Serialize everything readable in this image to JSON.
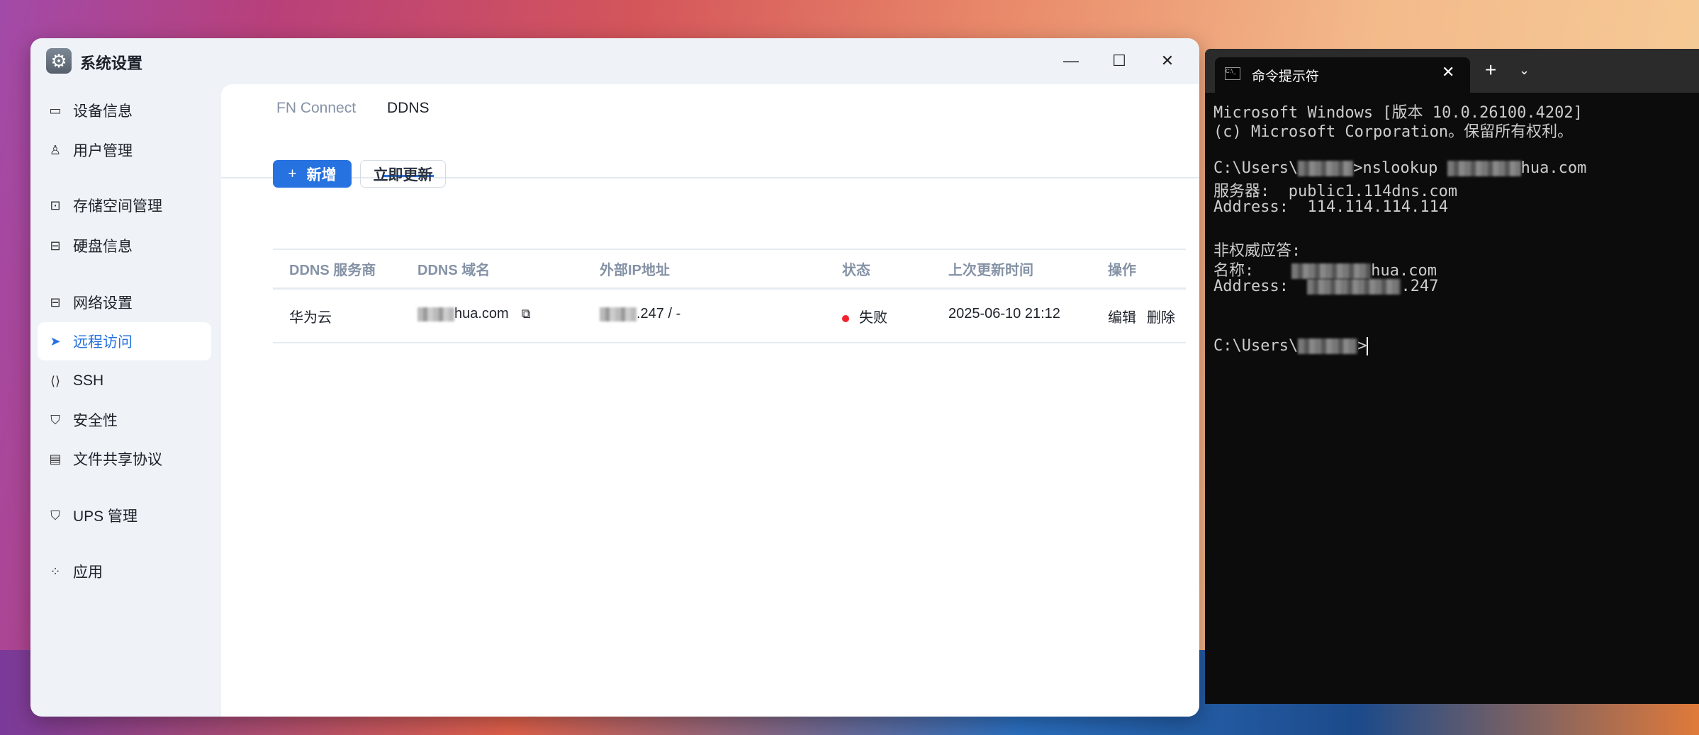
{
  "settings_window": {
    "title": "系统设置",
    "sidebar": [
      {
        "label": "设备信息",
        "icon": "device-icon"
      },
      {
        "label": "用户管理",
        "icon": "user-gear-icon"
      },
      {
        "label": "存储空间管理",
        "icon": "storage-icon"
      },
      {
        "label": "硬盘信息",
        "icon": "disk-icon"
      },
      {
        "label": "网络设置",
        "icon": "network-icon"
      },
      {
        "label": "远程访问",
        "icon": "send-icon",
        "active": true
      },
      {
        "label": "SSH",
        "icon": "code-icon"
      },
      {
        "label": "安全性",
        "icon": "shield-check-icon"
      },
      {
        "label": "文件共享协议",
        "icon": "file-icon"
      },
      {
        "label": "UPS 管理",
        "icon": "shield-icon"
      },
      {
        "label": "应用",
        "icon": "apps-icon"
      }
    ],
    "tabs": [
      "FN Connect",
      "DDNS"
    ],
    "active_tab": "DDNS",
    "add_button": "新增",
    "update_button": "立即更新",
    "table": {
      "headers": [
        "DDNS 服务商",
        "DDNS 域名",
        "外部IP地址",
        "状态",
        "上次更新时间",
        "操作"
      ],
      "rows": [
        {
          "provider": "华为云",
          "domain_suffix": "hua.com",
          "ip_suffix": ".247 / -",
          "status": "失败",
          "status_color": "#f5222d",
          "updated": "2025-06-10 21:12",
          "edit": "编辑",
          "delete": "删除"
        }
      ]
    },
    "accent": "#2672e0"
  },
  "terminal": {
    "tab_title": "命令提示符",
    "lines": {
      "l1": "Microsoft Windows [版本 10.0.26100.4202]",
      "l2": "(c) Microsoft Corporation。保留所有权利。",
      "l3a": "C:\\Users\\",
      "l3b": ">nslookup ",
      "l3c": "hua.com",
      "l4": "服务器:  public1.114dns.com",
      "l5": "Address:  114.114.114.114",
      "l6": "非权威应答:",
      "l7a": "名称:    ",
      "l7b": "hua.com",
      "l8a": "Address:  ",
      "l8b": ".247",
      "l9a": "C:\\Users\\",
      "l9b": ">"
    }
  }
}
